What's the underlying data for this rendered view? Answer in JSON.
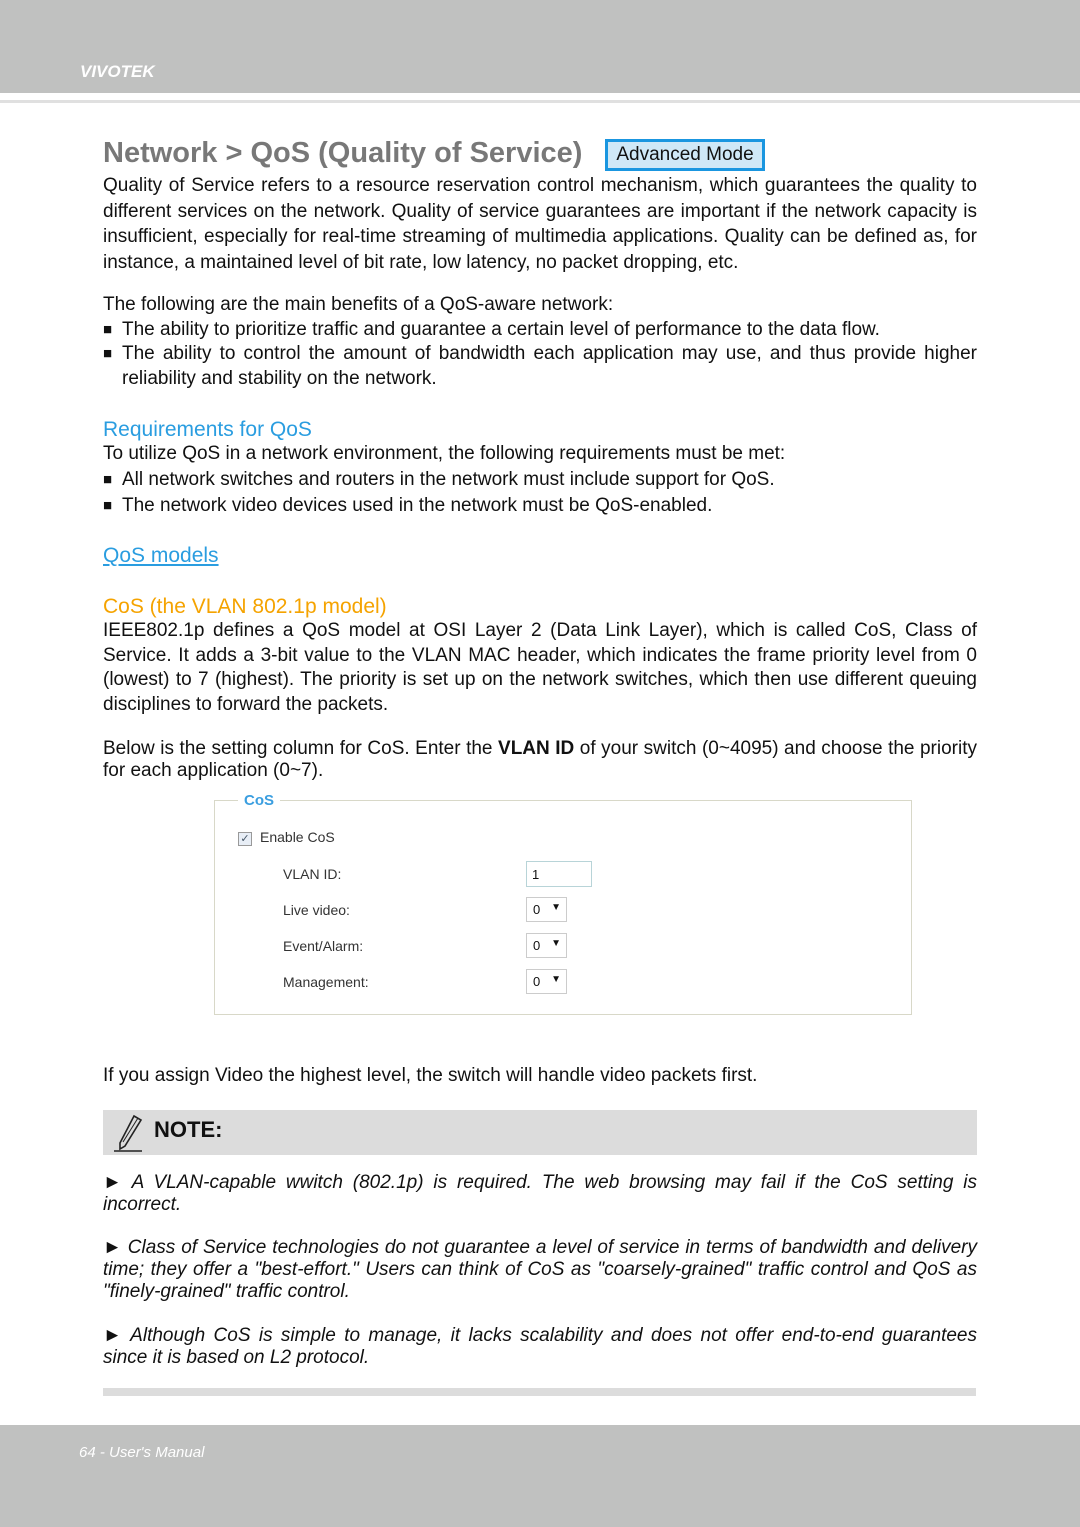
{
  "header": {
    "brand": "VIVOTEK"
  },
  "title": "Network > QoS (Quality of Service)",
  "mode_badge": "Advanced Mode",
  "intro": "Quality of Service refers to a resource reservation control mechanism, which guarantees the quality to different services on the network. Quality of service guarantees are important if the network capacity is insufficient, especially for real-time streaming of multimedia applications. Quality can be defined as, for instance, a maintained level of bit rate, low latency, no packet dropping, etc.",
  "benefits": {
    "lead": "The following are the main benefits of a QoS-aware network:",
    "items": [
      "The ability to prioritize traffic and guarantee a certain level of performance to the data flow.",
      "The ability to control the amount of bandwidth each application may use, and thus provide higher reliability and stability on the network."
    ]
  },
  "requirements": {
    "heading": "Requirements for QoS",
    "lead": "To utilize QoS in a network environment, the following requirements must be met:",
    "items": [
      "All network switches and routers in the network must include support for QoS.",
      "The network video devices used in the network must be QoS-enabled."
    ]
  },
  "qos_models_link": "QoS models",
  "cos": {
    "heading": "CoS (the VLAN 802.1p model)",
    "para": "IEEE802.1p defines a QoS model at OSI Layer 2 (Data Link Layer), which is called CoS, Class of Service. It adds a 3-bit value to the VLAN MAC header, which indicates the frame priority level from 0 (lowest) to 7 (highest). The priority is set up on the network switches, which then use different queuing disciplines to forward the packets.",
    "below_pre": "Below is the setting column for CoS. Enter the ",
    "below_bold": "VLAN ID",
    "below_post": " of your switch (0~4095) and choose the priority for each application (0~7)."
  },
  "cos_form": {
    "legend": "CoS",
    "enable_label": "Enable CoS",
    "enable_checked": true,
    "vlan_label": "VLAN ID:",
    "vlan_value": "1",
    "live_label": "Live video:",
    "live_value": "0",
    "event_label": "Event/Alarm:",
    "event_value": "0",
    "mgmt_label": "Management:",
    "mgmt_value": "0"
  },
  "after_form": "If you assign Video the highest level, the switch will handle video packets first.",
  "note": {
    "title": "NOTE:",
    "items": [
      "A VLAN-capable wwitch (802.1p) is required. The web browsing may fail if the CoS setting is incorrect.",
      "Class of Service technologies do not guarantee a level of service in terms of bandwidth and delivery time; they offer a \"best-effort.\" Users can think of CoS as \"coarsely-grained\" traffic control and QoS as \"finely-grained\" traffic control.",
      "Although CoS is simple to manage, it lacks scalability and does not offer end-to-end guarantees since it is based on L2 protocol."
    ]
  },
  "footer": {
    "page": "64 - User's Manual"
  }
}
